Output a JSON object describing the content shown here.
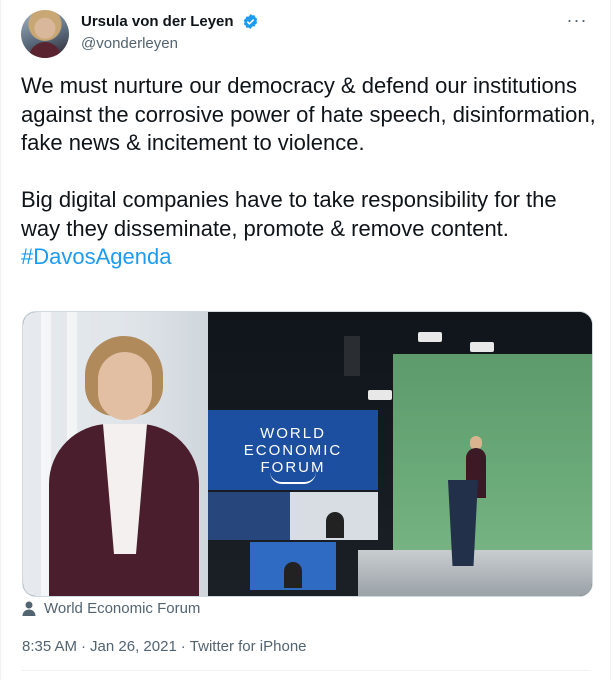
{
  "author": {
    "display_name": "Ursula von der Leyen",
    "handle": "@vonderleyen",
    "verified_icon": "verified-badge-icon",
    "avatar_icon": "avatar"
  },
  "menu": {
    "more_icon": "more-horizontal-icon",
    "more_label": "···"
  },
  "tweet": {
    "body": "We must nurture our democracy & defend our institutions against the corrosive power of hate speech, disinformation, fake news & incitement to violence.\n\nBig digital companies have to take responsibility for the way they disseminate, promote & remove content.\n",
    "hashtag": "#DavosAgenda"
  },
  "media": {
    "screen_text": "WORLD\nECONOMIC\nFORUM",
    "caption": "World Economic Forum",
    "caption_icon": "user-icon"
  },
  "meta": {
    "time": "8:35 AM",
    "date": "Jan 26, 2021",
    "source": "Twitter for iPhone",
    "separator": "·"
  },
  "colors": {
    "link": "#1d9bf0",
    "secondary_text": "#536471",
    "verified": "#1d9bf0"
  }
}
